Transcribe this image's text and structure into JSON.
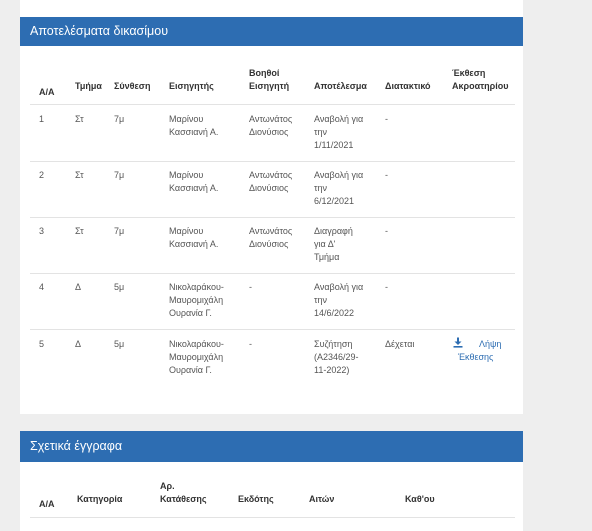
{
  "results": {
    "title": "Αποτελέσματα δικασίμου",
    "headers": {
      "aa": "Α/Α",
      "tmima": "Τμήμα",
      "synthesi": "Σύνθεση",
      "eisigitis": "Εισηγητής",
      "voithoi_1": "Βοηθοί",
      "voithoi_2": "Εισηγητή",
      "apotelesma": "Αποτέλεσμα",
      "diatakitko": "Διατακτικό",
      "ekthesi_1": "Έκθεση",
      "ekthesi_2": "Ακροατηρίου"
    },
    "rows": [
      {
        "aa": "1",
        "tmima": "Στ",
        "synthesi": "7μ",
        "eisigitis_1": "Μαρίνου",
        "eisigitis_2": "Κασσιανή Α.",
        "voithoi_1": "Αντωνάτος",
        "voithoi_2": "Διονύσιος",
        "apot_1": "Αναβολή για",
        "apot_2": "την",
        "apot_3": "1/11/2021",
        "diatakitko": "-"
      },
      {
        "aa": "2",
        "tmima": "Στ",
        "synthesi": "7μ",
        "eisigitis_1": "Μαρίνου",
        "eisigitis_2": "Κασσιανή Α.",
        "voithoi_1": "Αντωνάτος",
        "voithoi_2": "Διονύσιος",
        "apot_1": "Αναβολή για",
        "apot_2": "την",
        "apot_3": "6/12/2021",
        "diatakitko": "-"
      },
      {
        "aa": "3",
        "tmima": "Στ",
        "synthesi": "7μ",
        "eisigitis_1": "Μαρίνου",
        "eisigitis_2": "Κασσιανή Α.",
        "voithoi_1": "Αντωνάτος",
        "voithoi_2": "Διονύσιος",
        "apot_1": "Διαγραφή",
        "apot_2": "για Δ'",
        "apot_3": "Τμήμα",
        "diatakitko": "-"
      },
      {
        "aa": "4",
        "tmima": "Δ",
        "synthesi": "5μ",
        "eisigitis_1": "Νικολαράκου-",
        "eisigitis_2": "Μαυρομιχάλη",
        "eisigitis_3": "Ουρανία Γ.",
        "voithoi_1": "-",
        "apot_1": "Αναβολή για",
        "apot_2": "την",
        "apot_3": "14/6/2022",
        "diatakitko": "-"
      },
      {
        "aa": "5",
        "tmima": "Δ",
        "synthesi": "5μ",
        "eisigitis_1": "Νικολαράκου-",
        "eisigitis_2": "Μαυρομιχάλη",
        "eisigitis_3": "Ουρανία Γ.",
        "voithoi_1": "-",
        "apot_1": "Συζήτηση",
        "apot_2": "(Α2346/29-",
        "apot_3": "11-2022)",
        "diatakitko": "Δέχεται",
        "download_1": "Λήψη",
        "download_2": "Έκθεσης",
        "download_icon": "download-icon"
      }
    ]
  },
  "documents": {
    "title": "Σχετικά έγγραφα",
    "headers": {
      "aa": "Α/Α",
      "katigoria": "Κατηγορία",
      "ar_1": "Αρ.",
      "ar_2": "Κατάθεσης",
      "ekdotis": "Εκδότης",
      "aiton": "Αιτών",
      "kath_ou": "Καθ'ου"
    }
  }
}
